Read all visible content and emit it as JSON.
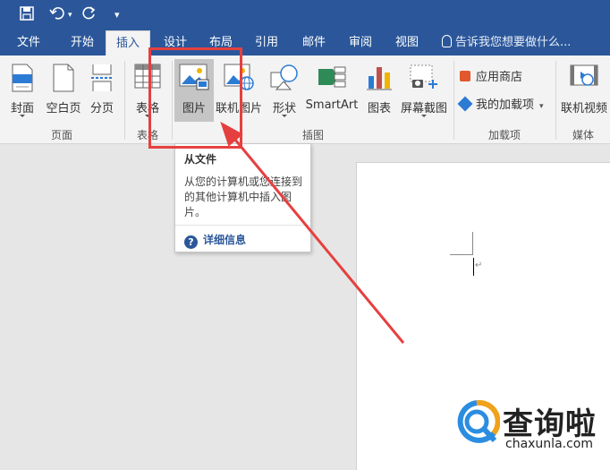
{
  "tabs": [
    {
      "label": "文件"
    },
    {
      "label": "开始"
    },
    {
      "label": "插入",
      "active": true
    },
    {
      "label": "设计"
    },
    {
      "label": "布局"
    },
    {
      "label": "引用"
    },
    {
      "label": "邮件"
    },
    {
      "label": "审阅"
    },
    {
      "label": "视图"
    }
  ],
  "tell_me": "告诉我您想要做什么...",
  "ribbon": {
    "cover": "封面",
    "blank_page": "空白页",
    "page_break": "分页",
    "table": "表格",
    "picture": "图片",
    "online_picture": "联机图片",
    "shapes": "形状",
    "smartart": "SmartArt",
    "chart": "图表",
    "screenshot": "屏幕截图",
    "store": "应用商店",
    "my_addins": "我的加载项",
    "online_video": "联机视频"
  },
  "groups": {
    "pages": "页面",
    "tables": "表格",
    "illustrations": "插图",
    "addins": "加载项",
    "media": "媒体"
  },
  "tooltip": {
    "title": "从文件",
    "description": "从您的计算机或您连接到的其他计算机中插入图片。",
    "more": "详细信息"
  },
  "watermark": {
    "text": "查询啦",
    "url": "chaxunla.com"
  },
  "colors": {
    "accent": "#2b579a",
    "annotation": "#e5403f"
  }
}
